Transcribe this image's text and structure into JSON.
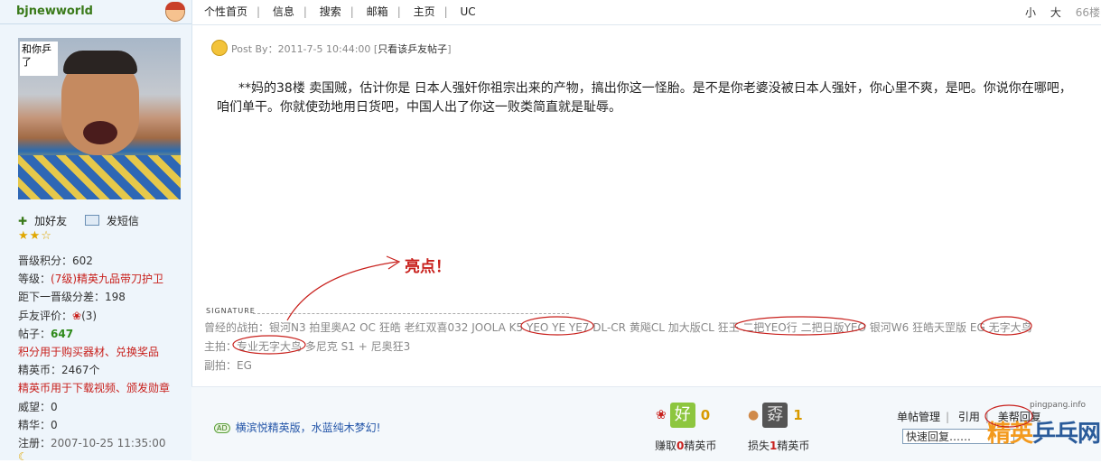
{
  "user": {
    "name": "bjnewworld",
    "avatar_caption": "和你乒了",
    "add_friend": "加好友",
    "send_message": "发短信",
    "stars": "★★☆",
    "stats": [
      {
        "label": "晋级积分：",
        "value": "602"
      },
      {
        "label": "等级：",
        "value": "(7级)精英九品带刀护卫"
      },
      {
        "label": "距下一晋级分差：",
        "value": "198"
      },
      {
        "label": "乒友评价：",
        "value": "(3)"
      },
      {
        "label": "帖子：",
        "value": "647"
      },
      {
        "note": "积分用于购买器材、兑换奖品"
      },
      {
        "label": "精英币：",
        "value": "2467个"
      },
      {
        "note": "精英币用于下载视频、颁发勋章"
      },
      {
        "label": "威望：",
        "value": "0"
      },
      {
        "label": "精华：",
        "value": "0"
      },
      {
        "label": "注册：",
        "value": "2007-10-25 11:35:00"
      }
    ]
  },
  "nav": {
    "items": [
      "个性首页",
      "信息",
      "搜索",
      "邮箱",
      "主页",
      "UC"
    ],
    "size_small": "小",
    "size_large": "大",
    "count": "66楼"
  },
  "post": {
    "meta": "Post By：2011-7-5 10:44:00 [",
    "only_this": "只看该乒友帖子",
    "meta_end": "]",
    "body": "**妈的38楼  卖国贼，估计你是  日本人强奸你祖宗出来的产物，搞出你这一怪胎。是不是你老婆没被日本人强奸，你心里不爽，是吧。你说你在哪吧，咱们单干。你就使劲地用日货吧，中国人出了你这一败类简直就是耻辱。"
  },
  "highlight": "亮点！",
  "signature": {
    "label": "SIGNATURE",
    "lines": [
      "曾经的战拍：银河N3 拍里奥A2 OC 狂皓  老红双喜032 JOOLA K5 YEO YE  YE7 DL-CR 黄飚CL 加大版CL 狂王  二把YEO行  二把日版YEO 银河W6 狂皓天罡版  EG  无字大鸟",
      "主拍：专业无字大鸟 多尼克  S1 + 尼奥狂3",
      "副拍：EG"
    ]
  },
  "footer": {
    "ad_badge": "AD",
    "ad_text": "横滨悦精英版，水蓝纯木梦幻!",
    "good_icon": "好",
    "good_count": "0",
    "good_pre": "赚取",
    "good_num": "0",
    "good_post": "精英币",
    "bad_icon": "孬",
    "bad_count": "1",
    "bad_pre": "损失",
    "bad_num": "1",
    "bad_post": "精英币",
    "manage": [
      "单帖管理",
      "引用",
      "美帮回复"
    ],
    "quick_reply": "快速回复……",
    "watermark_url": "pingpang.info",
    "watermark_logo_a": "精英",
    "watermark_logo_b": "乒乓网"
  }
}
